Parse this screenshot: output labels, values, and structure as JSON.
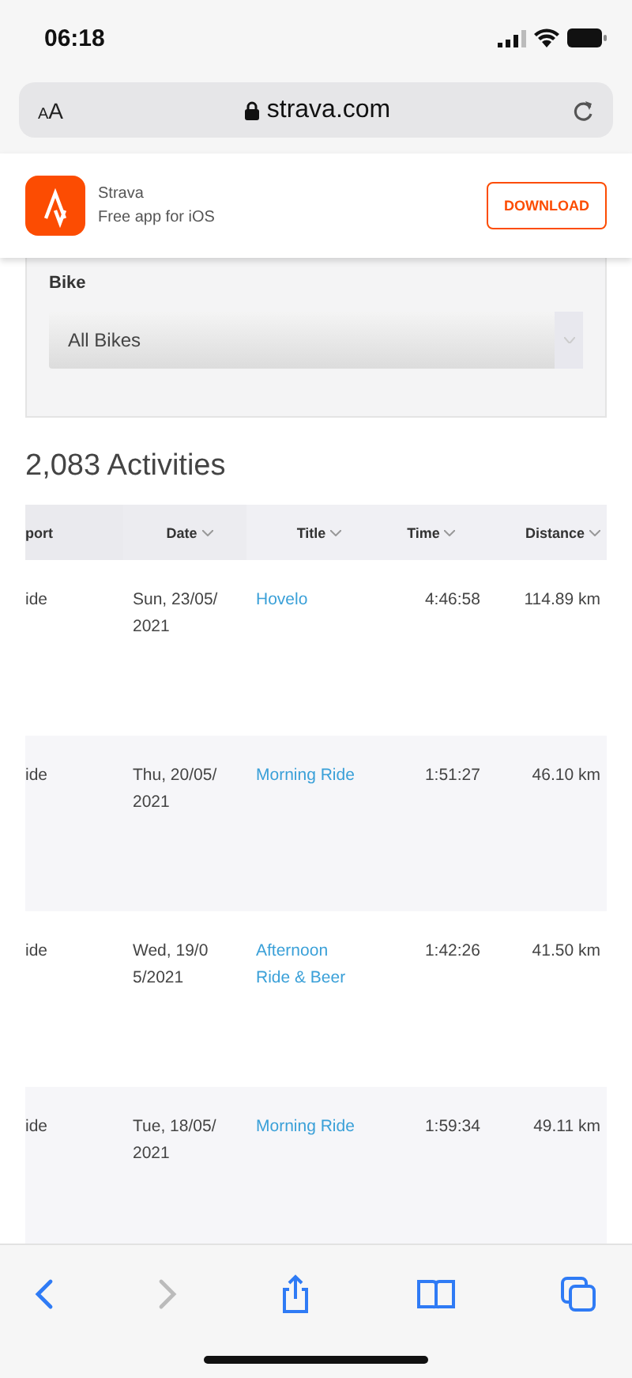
{
  "status_bar": {
    "time": "06:18"
  },
  "address_bar": {
    "text_size_button": "AA",
    "url": "strava.com"
  },
  "app_banner": {
    "name": "Strava",
    "subtitle": "Free app for iOS",
    "button": "DOWNLOAD"
  },
  "filter": {
    "label": "Bike",
    "select_value": "All Bikes"
  },
  "heading": "2,083 Activities",
  "table": {
    "columns": [
      {
        "label": "port",
        "sortable": false
      },
      {
        "label": "Date",
        "sortable": true
      },
      {
        "label": "Title",
        "sortable": true
      },
      {
        "label": "Time",
        "sortable": true
      },
      {
        "label": "Distance",
        "sortable": true
      }
    ],
    "rows": [
      {
        "sport": "ide",
        "date": "Sun, 23/05/2021",
        "title": "Hovelo",
        "time": "4:46:58",
        "distance": "114.89 km"
      },
      {
        "sport": "ide",
        "date": "Thu, 20/05/2021",
        "title": "Morning Ride",
        "time": "1:51:27",
        "distance": "46.10 km"
      },
      {
        "sport": "ide",
        "date": "Wed, 19/05/2021",
        "title": "Afternoon Ride & Beer",
        "time": "1:42:26",
        "distance": "41.50 km"
      },
      {
        "sport": "ide",
        "date": "Tue, 18/05/2021",
        "title": "Morning Ride",
        "time": "1:59:34",
        "distance": "49.11 km"
      }
    ]
  },
  "toolbar": [
    {
      "kind": "back",
      "disabled": false
    },
    {
      "kind": "forward",
      "disabled": true
    },
    {
      "kind": "share",
      "disabled": false
    },
    {
      "kind": "bookmarks",
      "disabled": false
    },
    {
      "kind": "tabs",
      "disabled": false
    }
  ]
}
